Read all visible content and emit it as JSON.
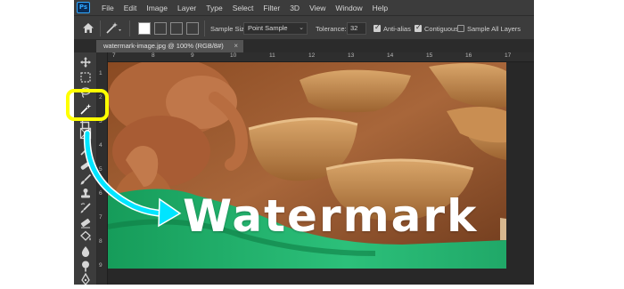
{
  "menu": {
    "logo": "Ps",
    "items": [
      "File",
      "Edit",
      "Image",
      "Layer",
      "Type",
      "Select",
      "Filter",
      "3D",
      "View",
      "Window",
      "Help"
    ]
  },
  "options": {
    "sample_size_label": "Sample Size:",
    "sample_size_value": "Point Sample",
    "tolerance_label": "Tolerance:",
    "tolerance_value": "32",
    "anti_alias_label": "Anti-alias",
    "anti_alias_checked": true,
    "contiguous_label": "Contiguous",
    "contiguous_checked": true,
    "sample_all_layers_label": "Sample All Layers",
    "sample_all_layers_checked": false
  },
  "document": {
    "tab_title": "watermark-image.jpg @ 100% (RGB/8#)",
    "close_glyph": "×"
  },
  "rulers": {
    "horizontal": [
      "7",
      "8",
      "9",
      "10",
      "11",
      "12",
      "13",
      "14",
      "15",
      "16",
      "17"
    ],
    "vertical": [
      "1",
      "2",
      "3",
      "4",
      "5",
      "6",
      "7",
      "8",
      "9"
    ]
  },
  "image": {
    "watermark_text": "Watermark"
  },
  "tools": [
    "move-tool-icon",
    "marquee-tool-icon",
    "lasso-tool-icon",
    "magic-wand-tool-icon",
    "crop-tool-icon",
    "frame-tool-icon",
    "eyedropper-tool-icon",
    "spot-healing-tool-icon",
    "brush-tool-icon",
    "clone-stamp-tool-icon",
    "history-brush-tool-icon",
    "eraser-tool-icon",
    "paint-bucket-tool-icon",
    "blur-tool-icon",
    "dodge-tool-icon",
    "pen-tool-icon"
  ],
  "annotation": {
    "highlight_color": "#ffff00",
    "arrow_color": "#00e5ff"
  }
}
